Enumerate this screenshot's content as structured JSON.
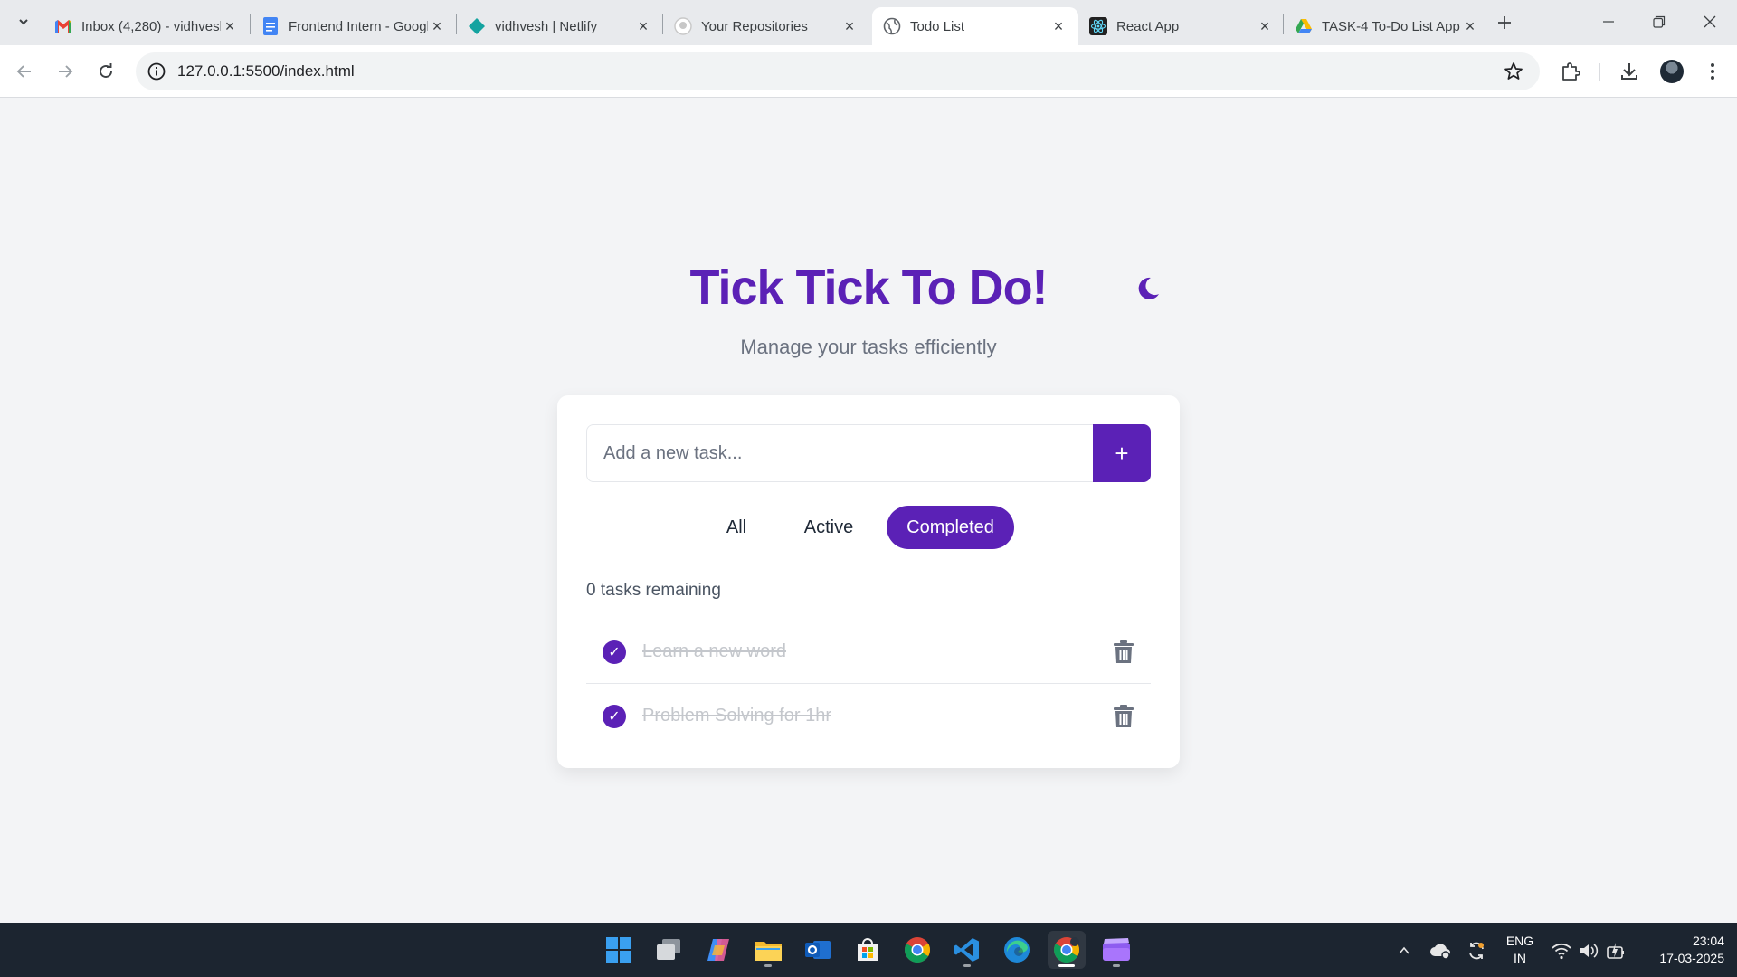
{
  "browser": {
    "tabs": [
      {
        "title": "Inbox (4,280) - vidhvesh",
        "icon": "gmail-icon",
        "active": false
      },
      {
        "title": "Frontend Intern - Google Docs",
        "icon": "docs-icon",
        "active": false
      },
      {
        "title": "vidhvesh | Netlify",
        "icon": "netlify-icon",
        "active": false
      },
      {
        "title": "Your Repositories",
        "icon": "github-icon",
        "active": false
      },
      {
        "title": "Todo List",
        "icon": "globe-icon",
        "active": true
      },
      {
        "title": "React App",
        "icon": "react-icon",
        "active": false
      },
      {
        "title": "TASK-4 To-Do List App",
        "icon": "drive-icon",
        "active": false
      }
    ],
    "url": "127.0.0.1:5500/index.html"
  },
  "app": {
    "title": "Tick Tick To Do!",
    "subtitle": "Manage your tasks efficiently",
    "input_placeholder": "Add a new task...",
    "add_label": "+",
    "filters": [
      {
        "label": "All",
        "selected": false
      },
      {
        "label": "Active",
        "selected": false
      },
      {
        "label": "Completed",
        "selected": true
      }
    ],
    "remaining": "0 tasks remaining",
    "tasks": [
      {
        "text": "Learn a new word",
        "completed": true
      },
      {
        "text": "Problem Solving for 1hr",
        "completed": true
      }
    ],
    "check_glyph": "✓",
    "accent_color": "#5b21b6"
  },
  "taskbar": {
    "apps": [
      "windows-start",
      "task-view",
      "copilot",
      "file-explorer",
      "outlook",
      "microsoft-store",
      "chrome",
      "vs-code",
      "edge",
      "chrome-profile",
      "clipchamp"
    ],
    "tray": {
      "language_line1": "ENG",
      "language_line2": "IN",
      "time": "23:04",
      "date": "17-03-2025"
    }
  }
}
